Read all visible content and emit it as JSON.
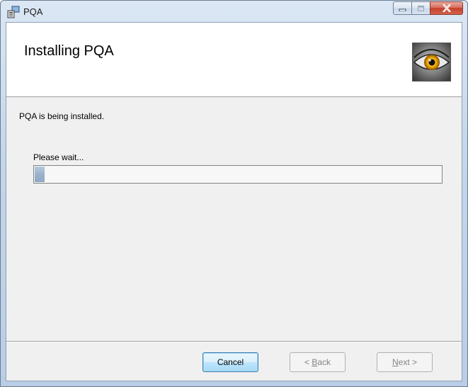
{
  "window": {
    "title": "PQA",
    "icons": {
      "app": "installer-icon",
      "minimize": "minimize-icon",
      "maximize": "maximize-icon",
      "close": "close-icon",
      "banner": "eye-icon"
    }
  },
  "banner": {
    "title": "Installing PQA"
  },
  "body": {
    "status": "PQA is being installed.",
    "wait_label": "Please wait...",
    "progress_percent": 2.5
  },
  "buttons": {
    "cancel": {
      "label": "Cancel"
    },
    "back": {
      "prefix": "< ",
      "access": "B",
      "rest": "ack"
    },
    "next": {
      "access": "N",
      "rest": "ext",
      "suffix": " >"
    }
  },
  "colors": {
    "progress_fill": "#9bb2cc",
    "close_button": "#c5412b",
    "eye_iris": "#f0a800"
  }
}
